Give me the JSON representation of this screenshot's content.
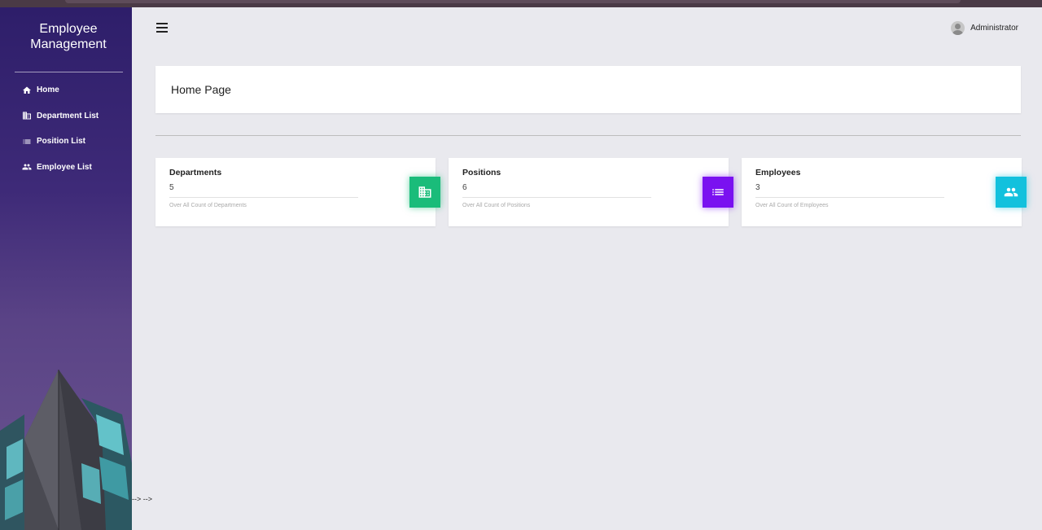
{
  "app": {
    "brand_line1": "Employee",
    "brand_line2": "Management"
  },
  "sidebar": {
    "items": [
      {
        "label": "Home",
        "icon": "home-icon"
      },
      {
        "label": "Department List",
        "icon": "building-icon"
      },
      {
        "label": "Position List",
        "icon": "list-icon"
      },
      {
        "label": "Employee List",
        "icon": "people-icon"
      }
    ]
  },
  "header": {
    "user_name": "Administrator"
  },
  "main": {
    "page_title": "Home Page",
    "stats": [
      {
        "label": "Departments",
        "value": "5",
        "caption": "Over All Count of Departments",
        "color": "#1abc7a",
        "icon": "building-icon"
      },
      {
        "label": "Positions",
        "value": "6",
        "caption": "Over All Count of Positions",
        "color": "#7a11f0",
        "icon": "list-icon"
      },
      {
        "label": "Employees",
        "value": "3",
        "caption": "Over All Count of Employees",
        "color": "#12c1dd",
        "icon": "people-icon"
      }
    ]
  },
  "footer_artifact": "--> -->"
}
